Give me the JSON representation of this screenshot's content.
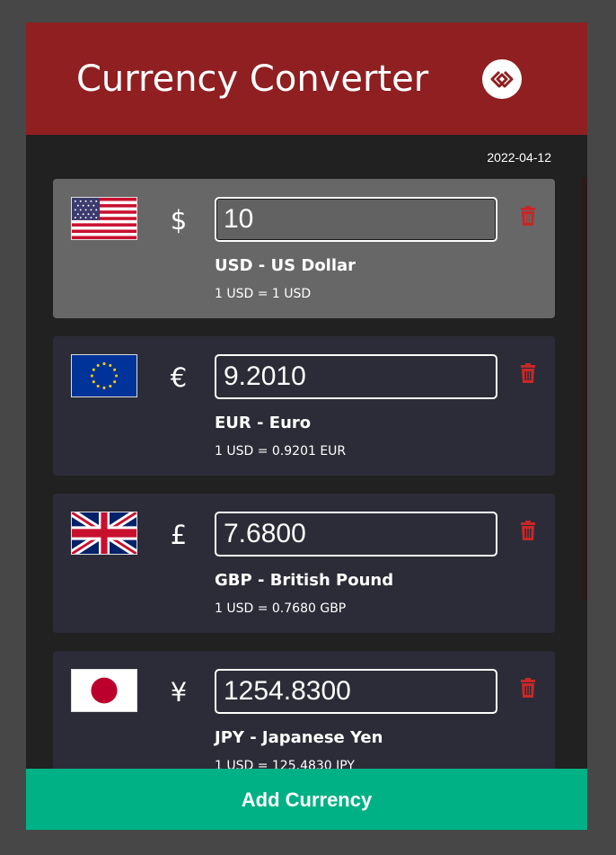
{
  "header": {
    "title": "Currency Converter",
    "logo_icon": "diamond-link-icon",
    "background": "#8f1f21"
  },
  "date": "2022-04-12",
  "currencies": [
    {
      "code_name": "USD - US Dollar",
      "symbol": "$",
      "amount": "10",
      "rate": "1 USD = 1 USD",
      "flag": "us-flag",
      "active": true
    },
    {
      "code_name": "EUR - Euro",
      "symbol": "€",
      "amount": "9.2010",
      "rate": "1 USD = 0.9201 EUR",
      "flag": "eu-flag",
      "active": false
    },
    {
      "code_name": "GBP - British Pound",
      "symbol": "£",
      "amount": "7.6800",
      "rate": "1 USD = 0.7680 GBP",
      "flag": "uk-flag",
      "active": false
    },
    {
      "code_name": "JPY - Japanese Yen",
      "symbol": "¥",
      "amount": "1254.8300",
      "rate": "1 USD = 125.4830 JPY",
      "flag": "jp-flag",
      "active": false
    }
  ],
  "delete_icon": "trash-icon",
  "delete_color": "#c62828",
  "add_button": {
    "label": "Add Currency",
    "color": "#00b185"
  }
}
